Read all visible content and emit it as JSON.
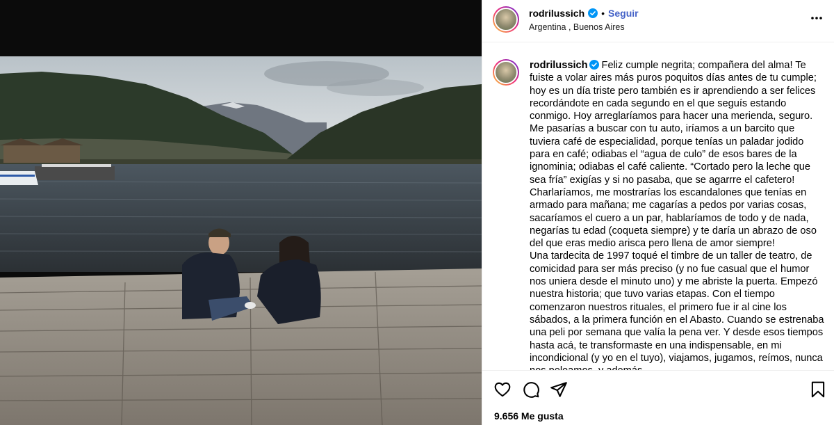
{
  "post": {
    "username": "rodrilussich",
    "separator": "•",
    "follow_label": "Seguir",
    "location": "Argentina , Buenos Aires",
    "more_label": "•••",
    "caption": "Feliz cumple negrita; compañera del alma! Te fuiste a volar aires más puros poquitos días antes de tu cumple; hoy es un día triste pero también es ir aprendiendo a ser felices recordándote en cada segundo en el que seguís estando conmigo. Hoy arreglaríamos para hacer una merienda, seguro. Me pasarías a buscar con tu auto, iríamos a un barcito que tuviera café de especialidad, porque tenías un paladar jodido para en café; odiabas el “agua de culo” de esos bares de la ignominia; odiabas el café caliente. “Cortado pero la leche que sea fría” exigías y si no pasaba, que se agarrre el cafetero! Charlaríamos, me mostrarías los escandalones que tenías en armado para mañana; me cagarías a pedos por varias cosas, sacaríamos el cuero a un par, hablaríamos de todo y de nada, negarías tu edad (coqueta siempre) y te daría un abrazo de oso del que eras medio arisca pero llena de amor siempre!\nUna tardecita de 1997 toqué el timbre de un taller de teatro, de comicidad para ser más preciso (y no fue casual que el humor nos uniera desde el minuto uno) y me abriste la puerta. Empezó nuestra historia; que tuvo varias etapas. Con el tiempo comenzaron nuestros rituales, el primero fue ir al cine los sábados, a la primera función en el Abasto. Cuando se estrenaba una peli por semana que valía la pena ver. Y desde esos tiempos hasta acá, te transformaste en una indispensable, en mi incondicional (y yo en el tuyo), viajamos, jugamos, reímos, nunca nos peleamos, y además",
    "likes": "9.656 Me gusta"
  },
  "colors": {
    "follow": "#4462c7",
    "verified": "#0095f6",
    "ig_gradient": [
      "#f9ce34",
      "#ee2a7b",
      "#6228d7"
    ]
  },
  "icons": {
    "like": "heart-icon",
    "comment": "comment-icon",
    "share": "send-icon",
    "save": "bookmark-icon",
    "verified": "verified-badge-icon",
    "more": "more-options-icon"
  }
}
